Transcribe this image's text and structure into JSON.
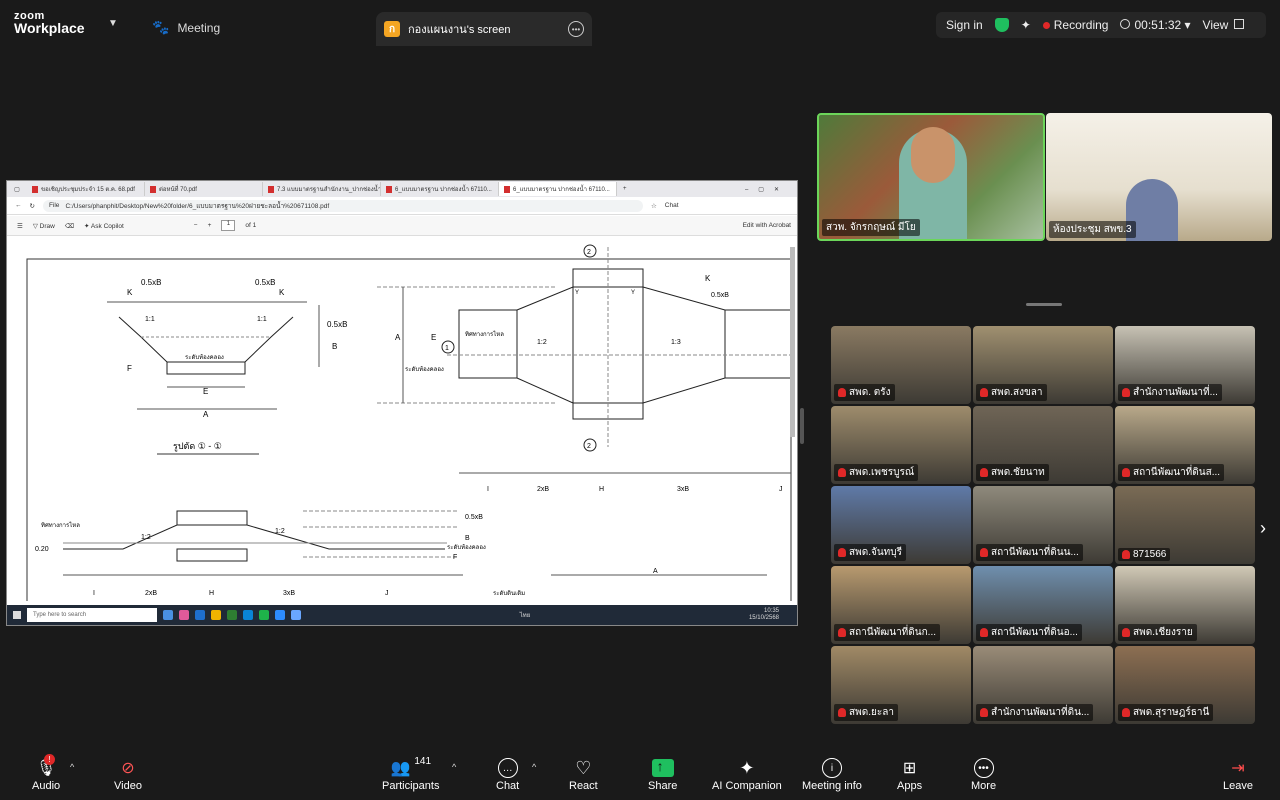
{
  "topbar": {
    "logo_line1": "zoom",
    "logo_line2": "Workplace",
    "meeting_tab": "Meeting",
    "share_initial": "ก",
    "share_label": "กองแผนงาน's screen",
    "sign_in": "Sign in",
    "recording": "Recording",
    "timer": "00:51:32",
    "view": "View"
  },
  "browser": {
    "tabs": [
      {
        "label": "ขอเชิญประชุมประจำ 15 ต.ค. 68.pdf"
      },
      {
        "label": "ต่อหน้ที่ 70.pdf"
      },
      {
        "label": "7.3 แบบมาตรฐานสำนักงาน_ปากช่องน้ำ 67110..."
      },
      {
        "label": "6_แบบมาตรฐาน ปากช่องน้ำ 67110..."
      },
      {
        "label": "6_แบบมาตรฐาน ปากช่องน้ำ 67110..."
      }
    ],
    "file_label": "File",
    "address": "C:/Users/phanphit/Desktop/New%20folder/6_แบบมาตรฐาน%20ฝายชะลอน้ำ%20671108.pdf",
    "chat": "Chat"
  },
  "pdf_toolbar": {
    "draw": "Draw",
    "ask": "Ask Copilot",
    "page": "1",
    "of": "of 1",
    "edit": "Edit with Acrobat"
  },
  "drawing": {
    "k": "K",
    "half_b": "0.5xB",
    "b": "B",
    "a": "A",
    "e": "E",
    "f": "F",
    "canal_bed": "ระดับท้องคลอง",
    "flow_dir": "ทิศทางการไหล",
    "one": "1",
    "two": "2",
    "slope_1_1": "1:1",
    "slope_1_2": "1:2",
    "slope_1_3": "1:3",
    "section_title": "รูปตัด ① - ①",
    "y": "Y",
    "i": "I",
    "twoxb": "2xB",
    "h": "H",
    "threexb": "3xB",
    "j": "J",
    "elev": "0.20",
    "orig_level": "ระดับดินเดิม"
  },
  "taskbar": {
    "search": "Type here to search",
    "lang": "ไทย",
    "time": "10:35",
    "date": "15/10/2568"
  },
  "speakers": [
    {
      "label": "สวพ. จักรกฤษณ์ มีโย"
    },
    {
      "label": "ห้องประชุม สพข.3"
    }
  ],
  "gallery": [
    {
      "label": "สพด. ตรัง"
    },
    {
      "label": "สพด.สงขลา"
    },
    {
      "label": "สำนักงานพัฒนาที่..."
    },
    {
      "label": "สพด.เพชรบูรณ์"
    },
    {
      "label": "สพด.ชัยนาท"
    },
    {
      "label": "สถานีพัฒนาที่ดินส..."
    },
    {
      "label": "สพด.จันทบุรี"
    },
    {
      "label": "สถานีพัฒนาที่ดินน..."
    },
    {
      "label": "871566"
    },
    {
      "label": "สถานีพัฒนาที่ดินก..."
    },
    {
      "label": "สถานีพัฒนาที่ดินอ..."
    },
    {
      "label": "สพด.เชียงราย"
    },
    {
      "label": "สพด.ยะลา"
    },
    {
      "label": "สำนักงานพัฒนาที่ดิน..."
    },
    {
      "label": "สพด.สุราษฎร์ธานี"
    }
  ],
  "bottombar": {
    "audio": "Audio",
    "audio_badge": "!",
    "video": "Video",
    "participants": "Participants",
    "participants_count": "141",
    "chat": "Chat",
    "react": "React",
    "share": "Share",
    "ai": "AI Companion",
    "info": "Meeting info",
    "apps": "Apps",
    "more": "More",
    "leave": "Leave"
  },
  "colors": {
    "accent_green": "#1fbf5f",
    "record_red": "#e02828",
    "speaker_border": "#6cd65a"
  }
}
